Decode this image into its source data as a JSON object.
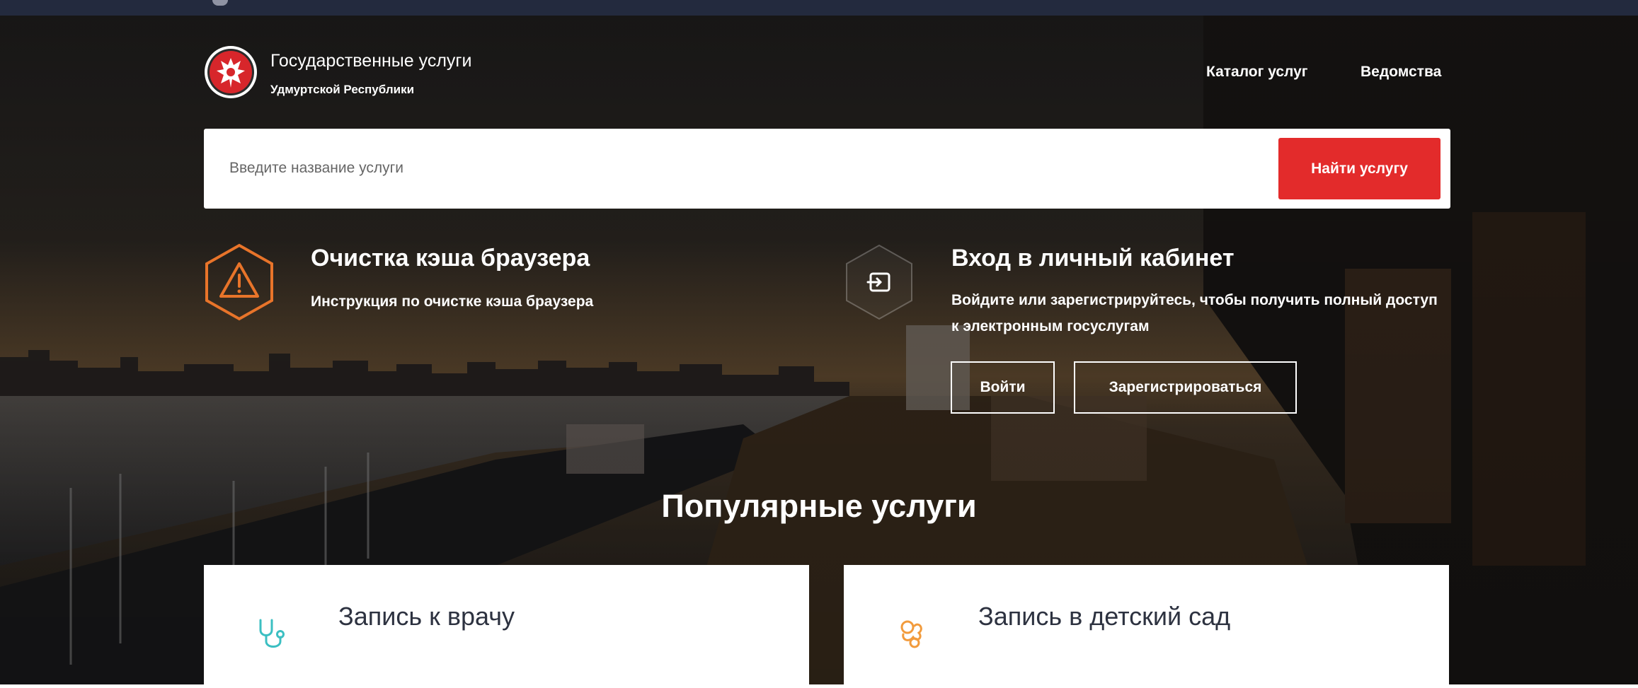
{
  "header": {
    "brand_title": "Государственные услуги",
    "brand_subtitle": "Удмуртской Республики",
    "nav": [
      {
        "label": "Каталог услуг"
      },
      {
        "label": "Ведомства"
      }
    ]
  },
  "search": {
    "placeholder": "Введите название услуги",
    "value": "",
    "button_label": "Найти услугу"
  },
  "cache_block": {
    "icon": "warning-icon",
    "title": "Очистка кэша браузера",
    "text": "Инструкция по очистке кэша браузера"
  },
  "login_block": {
    "icon": "login-icon",
    "title": "Вход в личный кабинет",
    "text": "Войдите или зарегистрируйтесь, чтобы получить полный доступ к электронным госуслугам",
    "login_button": "Войти",
    "register_button": "Зарегистрироваться"
  },
  "popular": {
    "title": "Популярные услуги",
    "cards": [
      {
        "label": "Запись к врачу",
        "icon": "stethoscope-icon",
        "icon_color": "#3bbfc2"
      },
      {
        "label": "Запись в детский сад",
        "icon": "pacifier-icon",
        "icon_color": "#f29b3c"
      }
    ]
  },
  "colors": {
    "accent_red": "#e32b2b",
    "warning_orange": "#e8742a",
    "topbar": "#232a3e"
  }
}
